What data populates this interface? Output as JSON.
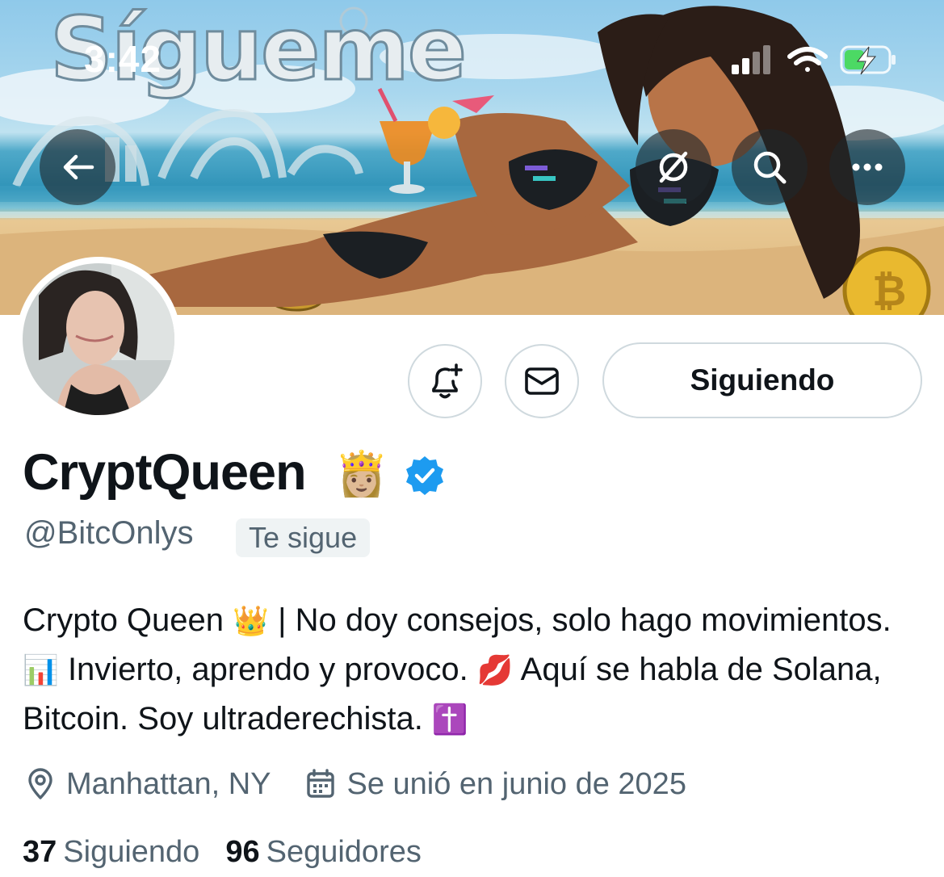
{
  "status_bar": {
    "time": "3:42"
  },
  "banner": {
    "title": "Sígueme"
  },
  "profile": {
    "display_name": "CryptQueen",
    "name_emoji": "👸🏼",
    "handle": "@BitcOnlys",
    "follows_you_badge": "Te sigue",
    "verified": true,
    "bio": {
      "part1": "Crypto Queen ",
      "emoji1": "👑",
      "part2": " | No doy consejos, solo hago movimientos.",
      "emoji2": "📊",
      "part3": " Invierto, aprendo y provoco. ",
      "emoji3": "💋",
      "part4": " Aquí se habla de Solana, Bitcoin. Soy ultraderechista. ",
      "emoji4": "✝️"
    },
    "location": "Manhattan, NY",
    "joined": "Se unió en junio de 2025",
    "following_count": "37",
    "following_label": "Siguiendo",
    "followers_count": "96",
    "followers_label": "Seguidores"
  },
  "actions": {
    "follow_button_label": "Siguiendo"
  },
  "icons": {
    "back": "arrow-left-icon",
    "grok": "grok-icon",
    "search": "search-icon",
    "more": "more-icon",
    "notify": "bell-plus-icon",
    "message": "envelope-icon",
    "location": "location-pin-icon",
    "calendar": "calendar-icon",
    "verified": "verified-badge-icon"
  },
  "colors": {
    "accent_blue": "#1d9bf0",
    "secondary_text": "#536471",
    "primary_text": "#0f1419",
    "border": "#cfd9de"
  }
}
